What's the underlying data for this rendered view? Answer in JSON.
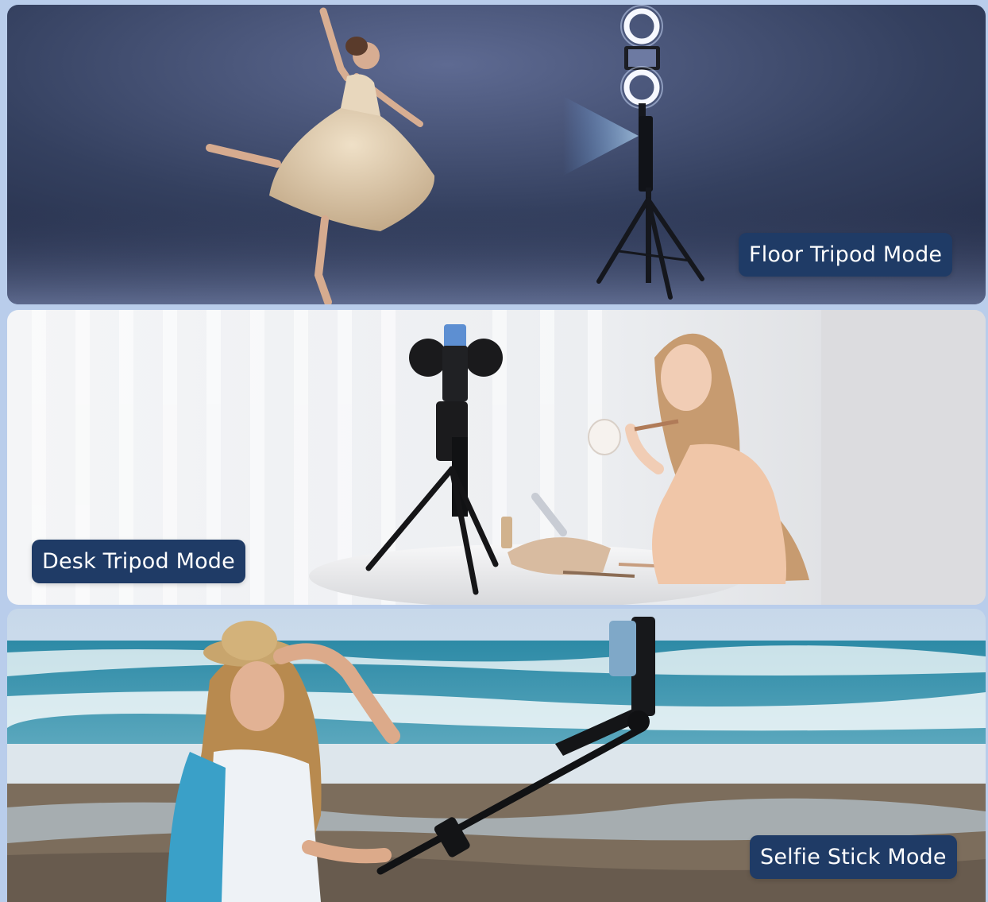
{
  "colors": {
    "page_background": "#b9cdeb",
    "badge_background": "#1f3b66",
    "badge_text": "#ffffff"
  },
  "modes": [
    {
      "label": "Floor Tripod Mode",
      "scene": "dancer-on-stage-with-ring-light-floor-tripod"
    },
    {
      "label": "Desk Tripod Mode",
      "scene": "woman-applying-makeup-with-desk-tripod-phone"
    },
    {
      "label": "Selfie Stick Mode",
      "scene": "woman-at-beach-with-selfie-stick"
    }
  ],
  "icons": [
    "ring-light-icon",
    "tripod-icon",
    "phone-icon",
    "selfie-stick-icon"
  ]
}
